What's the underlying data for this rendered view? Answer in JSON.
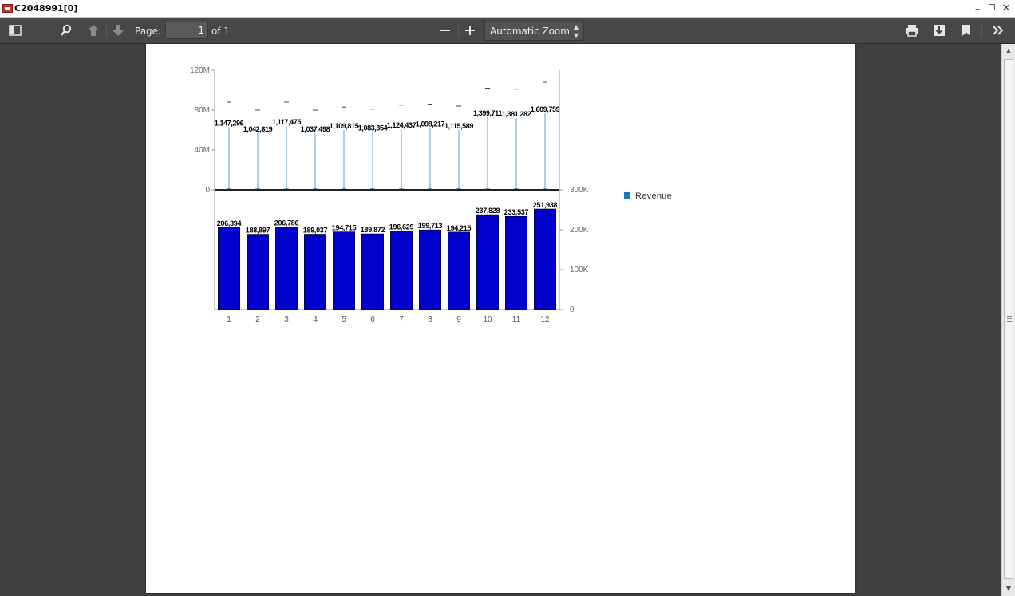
{
  "window": {
    "title": "C2048991[0]"
  },
  "toolbar": {
    "page_label": "Page:",
    "page_value": "1",
    "page_of": "of 1",
    "zoom_value": "Automatic Zoom"
  },
  "chart_data": {
    "type": "bar",
    "legend": {
      "entries": [
        "Revenue"
      ],
      "placement": "right",
      "swatch_color": "#1f77b4"
    },
    "categories": [
      "1",
      "2",
      "3",
      "4",
      "5",
      "6",
      "7",
      "8",
      "9",
      "10",
      "11",
      "12"
    ],
    "top_panel": {
      "type": "line",
      "axis_side": "left",
      "ylim": [
        0,
        120000000
      ],
      "tick_labels": [
        "0",
        "40M",
        "80M",
        "120M"
      ],
      "tick_values": [
        0,
        40000000,
        80000000,
        120000000
      ],
      "values": [
        63000000,
        57000000,
        64000000,
        57000000,
        60000000,
        58000000,
        61000000,
        62000000,
        60000000,
        73000000,
        72000000,
        77000000
      ],
      "dash_values": [
        88000000,
        80000000,
        88000000,
        80000000,
        83000000,
        81000000,
        85000000,
        86000000,
        84000000,
        102000000,
        101000000,
        108000000
      ],
      "data_labels": [
        "1,147,296",
        "1,042,819",
        "1,117,475",
        "1,037,498",
        "1,109,815",
        "1,083,354",
        "1,124,437",
        "1,098,217",
        "1,115,589",
        "1,399,711",
        "1,381,282",
        "1,609,759"
      ]
    },
    "bottom_panel": {
      "type": "bar",
      "axis_side": "right",
      "ylim": [
        0,
        300000
      ],
      "tick_labels": [
        "0",
        "100K",
        "200K",
        "300K"
      ],
      "tick_values": [
        0,
        100000,
        200000,
        300000
      ],
      "values": [
        206394,
        188897,
        206786,
        189037,
        194715,
        189872,
        196629,
        199713,
        194215,
        237828,
        233537,
        251938
      ],
      "data_labels": [
        "206,394",
        "188,897",
        "206,786",
        "189,037",
        "194,715",
        "189,872",
        "196,629",
        "199,713",
        "194,215",
        "237,828",
        "233,537",
        "251,938"
      ],
      "bar_color": "#0000cc"
    }
  }
}
